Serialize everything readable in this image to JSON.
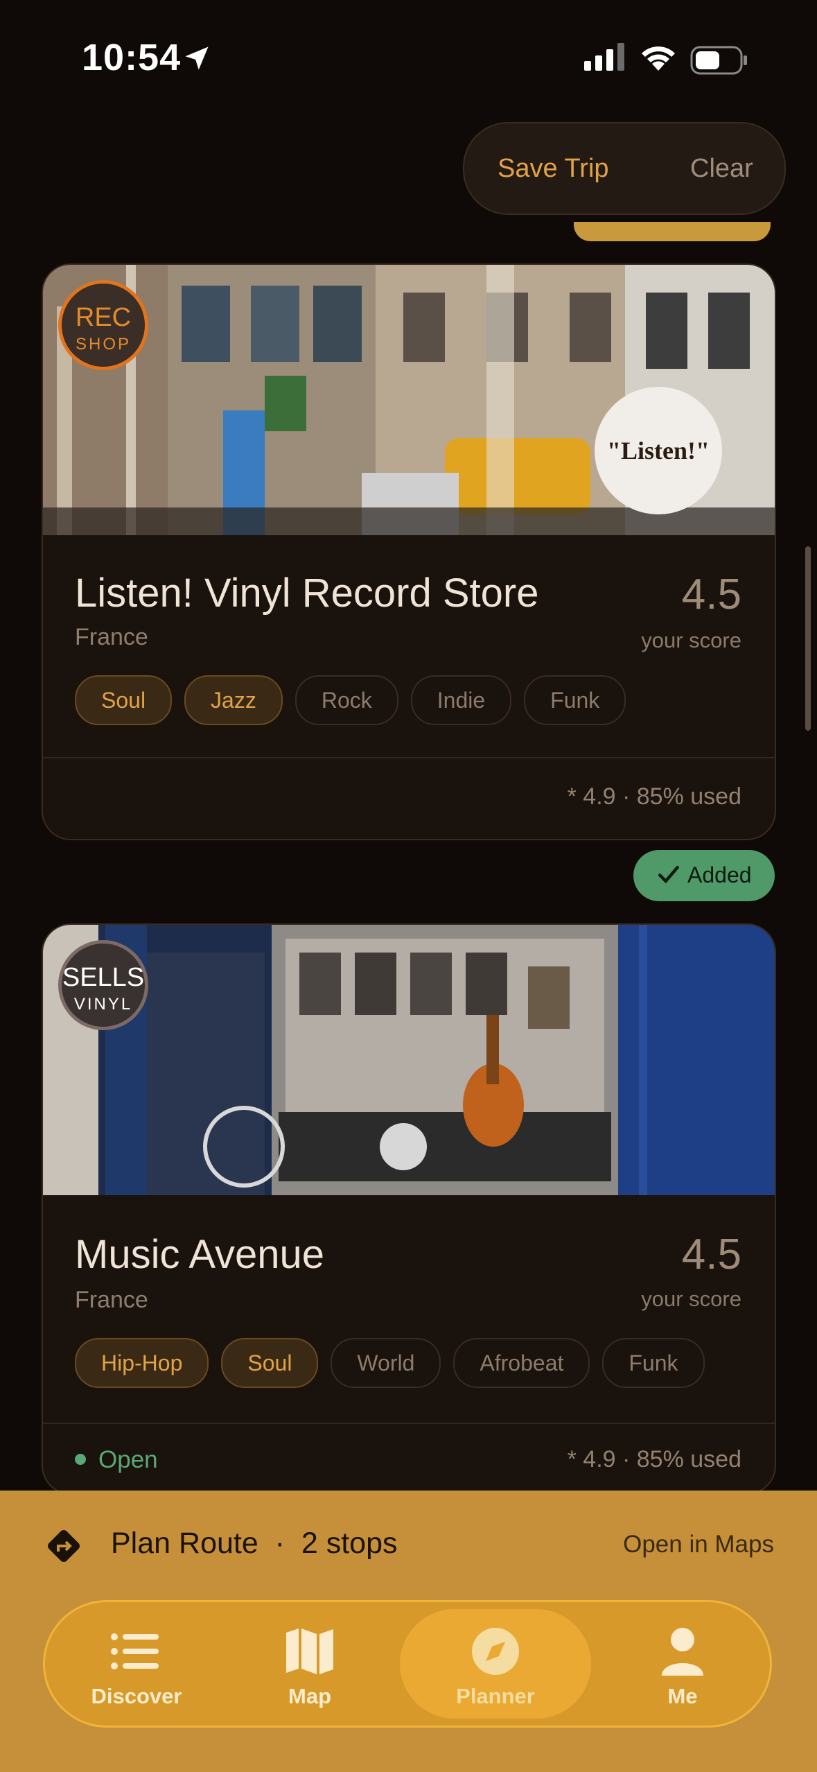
{
  "status_bar": {
    "time": "10:54"
  },
  "header": {
    "save_trip": "Save Trip",
    "clear": "Clear"
  },
  "cards": [
    {
      "badge_line1": "REC",
      "badge_line2": "SHOP",
      "sign_text": "\"Listen!\"",
      "title": "Listen! Vinyl Record Store",
      "country": "France",
      "score": "4.5",
      "score_label": "your score",
      "chips": [
        {
          "label": "Soul",
          "selected": true
        },
        {
          "label": "Jazz",
          "selected": true
        },
        {
          "label": "Rock",
          "selected": false
        },
        {
          "label": "Indie",
          "selected": false
        },
        {
          "label": "Funk",
          "selected": false
        }
      ],
      "footer_stats": "* 4.9 · 85% used"
    },
    {
      "badge_line1": "SELLS",
      "badge_line2": "VINYL",
      "title": "Music Avenue",
      "country": "France",
      "score": "4.5",
      "score_label": "your score",
      "chips": [
        {
          "label": "Hip-Hop",
          "selected": true
        },
        {
          "label": "Soul",
          "selected": true
        },
        {
          "label": "World",
          "selected": false
        },
        {
          "label": "Afrobeat",
          "selected": false
        },
        {
          "label": "Funk",
          "selected": false
        }
      ],
      "status": "Open",
      "footer_stats": "* 4.9 · 85% used"
    }
  ],
  "added_badge": "Added",
  "route": {
    "label": "Plan Route",
    "stops": "2 stops",
    "open_maps": "Open in Maps"
  },
  "tabs": [
    {
      "label": "Discover",
      "icon": "list-icon"
    },
    {
      "label": "Map",
      "icon": "map-icon"
    },
    {
      "label": "Planner",
      "icon": "compass-icon",
      "active": true
    },
    {
      "label": "Me",
      "icon": "person-icon"
    }
  ],
  "colors": {
    "accent": "#e2a24a",
    "added": "#4f9a68",
    "bottom_bar": "#c6903a"
  }
}
